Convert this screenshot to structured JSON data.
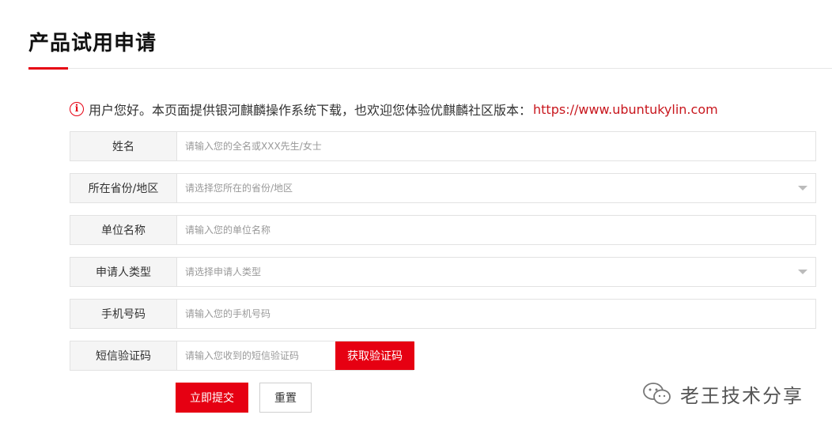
{
  "page": {
    "title": "产品试用申请"
  },
  "notice": {
    "icon": "info-circle-icon",
    "icon_glyph": "i",
    "text": "用户您好。本页面提供银河麒麟操作系统下载，也欢迎您体验优麒麟社区版本：",
    "link_text": "https://www.ubuntukylin.com"
  },
  "form": {
    "name": {
      "label": "姓名",
      "placeholder": "请输入您的全名或XXX先生/女士"
    },
    "region": {
      "label": "所在省份/地区",
      "placeholder": "请选择您所在的省份/地区"
    },
    "company": {
      "label": "单位名称",
      "placeholder": "请输入您的单位名称"
    },
    "applicant_type": {
      "label": "申请人类型",
      "placeholder": "请选择申请人类型"
    },
    "phone": {
      "label": "手机号码",
      "placeholder": "请输入您的手机号码"
    },
    "sms_code": {
      "label": "短信验证码",
      "placeholder": "请输入您收到的短信验证码",
      "button": "获取验证码"
    }
  },
  "actions": {
    "submit": "立即提交",
    "reset": "重置"
  },
  "watermark": {
    "icon": "wechat-icon",
    "text": "老王技术分享"
  },
  "colors": {
    "accent": "#e60012",
    "link": "#c8161d",
    "label_bg": "#f5f5f5",
    "border": "#e2e2e2"
  }
}
